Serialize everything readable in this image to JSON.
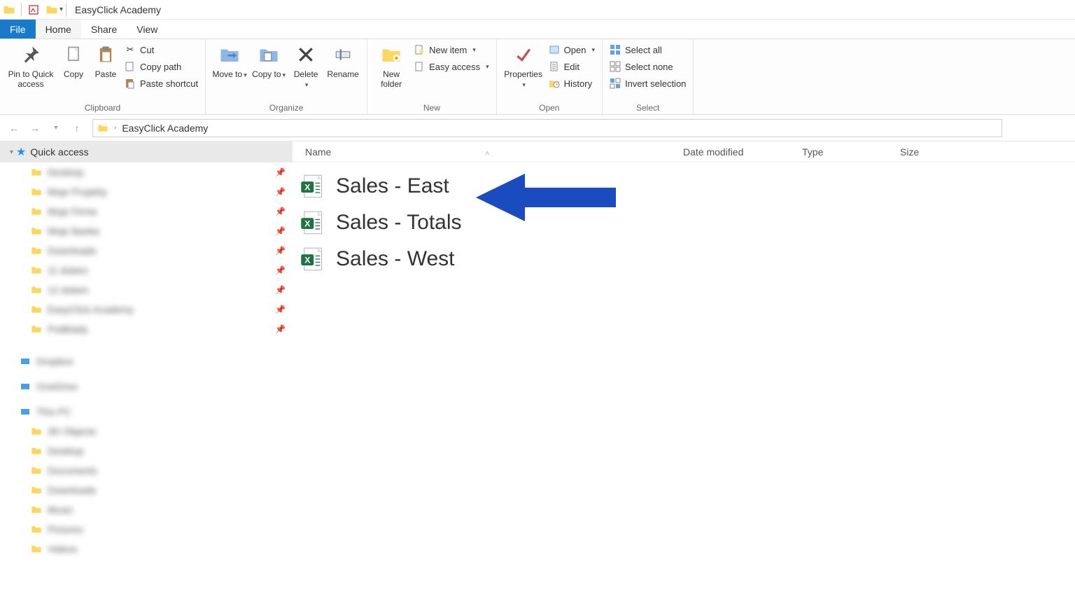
{
  "window": {
    "title": "EasyClick Academy"
  },
  "tabs": {
    "file": "File",
    "home": "Home",
    "share": "Share",
    "view": "View"
  },
  "ribbon": {
    "clipboard": {
      "label": "Clipboard",
      "pin": "Pin to Quick access",
      "copy": "Copy",
      "paste": "Paste",
      "cut": "Cut",
      "copypath": "Copy path",
      "pasteshortcut": "Paste shortcut"
    },
    "organize": {
      "label": "Organize",
      "moveto": "Move to",
      "copyto": "Copy to",
      "delete": "Delete",
      "rename": "Rename"
    },
    "new": {
      "label": "New",
      "newfolder": "New folder",
      "newitem": "New item",
      "easyaccess": "Easy access"
    },
    "open": {
      "label": "Open",
      "properties": "Properties",
      "open": "Open",
      "edit": "Edit",
      "history": "History"
    },
    "select": {
      "label": "Select",
      "selectall": "Select all",
      "selectnone": "Select none",
      "invert": "Invert selection"
    }
  },
  "breadcrumb": {
    "location": "EasyClick Academy"
  },
  "columns": {
    "name": "Name",
    "modified": "Date modified",
    "type": "Type",
    "size": "Size"
  },
  "nav": {
    "quick": "Quick access",
    "items": [
      "Desktop",
      "Moje Projekty",
      "Moje Firma",
      "Moje Banka",
      "Downloads",
      "11 duben",
      "12 duben",
      "EasyClick Academy",
      "Podklady"
    ],
    "roots": [
      "Dropbox",
      "OneDrive",
      "This PC"
    ],
    "pcitems": [
      "3D Objects",
      "Desktop",
      "Documents",
      "Downloads",
      "Music",
      "Pictures",
      "Videos"
    ]
  },
  "files": [
    {
      "name": "Sales - East"
    },
    {
      "name": "Sales - Totals"
    },
    {
      "name": "Sales - West"
    }
  ],
  "annotation": {
    "arrow_color": "#1a4bbf"
  }
}
